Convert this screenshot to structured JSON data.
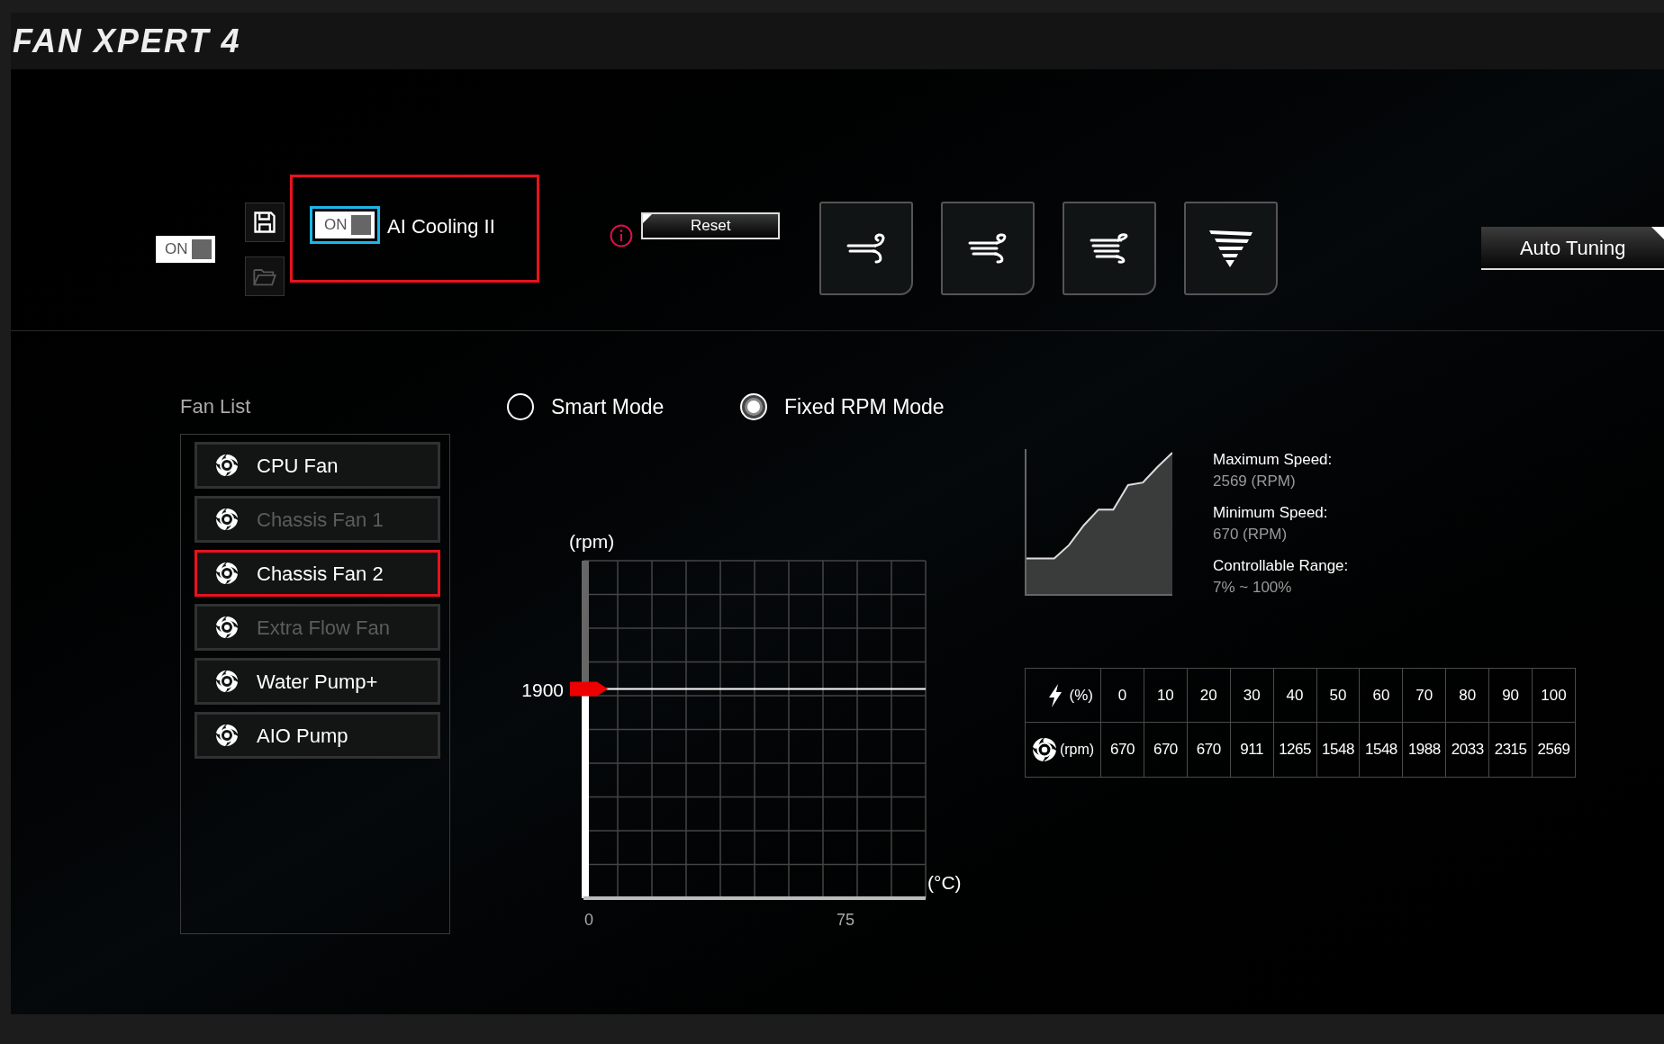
{
  "app": {
    "title": "FAN XPERT 4"
  },
  "toolbar": {
    "power_toggle": {
      "label": "ON",
      "on": true
    },
    "ai_cooling": {
      "toggle_label": "ON",
      "on": true,
      "label": "AI Cooling II",
      "highlighted": true
    },
    "reset_button": "Reset",
    "auto_tuning_button": "Auto Tuning"
  },
  "fan_list": {
    "title": "Fan List",
    "items": [
      {
        "name": "CPU Fan",
        "selected": false,
        "disabled": false
      },
      {
        "name": "Chassis Fan 1",
        "selected": false,
        "disabled": true
      },
      {
        "name": "Chassis Fan 2",
        "selected": true,
        "disabled": false
      },
      {
        "name": "Extra Flow Fan",
        "selected": false,
        "disabled": true
      },
      {
        "name": "Water Pump+",
        "selected": false,
        "disabled": false
      },
      {
        "name": "AIO Pump",
        "selected": false,
        "disabled": false
      }
    ]
  },
  "modes": [
    {
      "label": "Smart Mode",
      "selected": false
    },
    {
      "label": "Fixed RPM Mode",
      "selected": true
    }
  ],
  "rpm_slider": {
    "y_label": "(rpm)",
    "x_label": "(°C)",
    "x_ticks": [
      "0",
      "75"
    ],
    "value_label": "1900",
    "level": 0.62
  },
  "specs": [
    {
      "label": "Maximum Speed:",
      "value": "2569 (RPM)"
    },
    {
      "label": "Minimum Speed:",
      "value": "670 (RPM)"
    },
    {
      "label": "Controllable Range:",
      "value": "7% ~ 100%"
    }
  ],
  "speed_table": {
    "duty_header": "(%)",
    "rpm_header": "(rpm)",
    "duty": [
      "0",
      "10",
      "20",
      "30",
      "40",
      "50",
      "60",
      "70",
      "80",
      "90",
      "100"
    ],
    "rpm": [
      "670",
      "670",
      "670",
      "911",
      "1265",
      "1548",
      "1548",
      "1988",
      "2033",
      "2315",
      "2569"
    ]
  }
}
